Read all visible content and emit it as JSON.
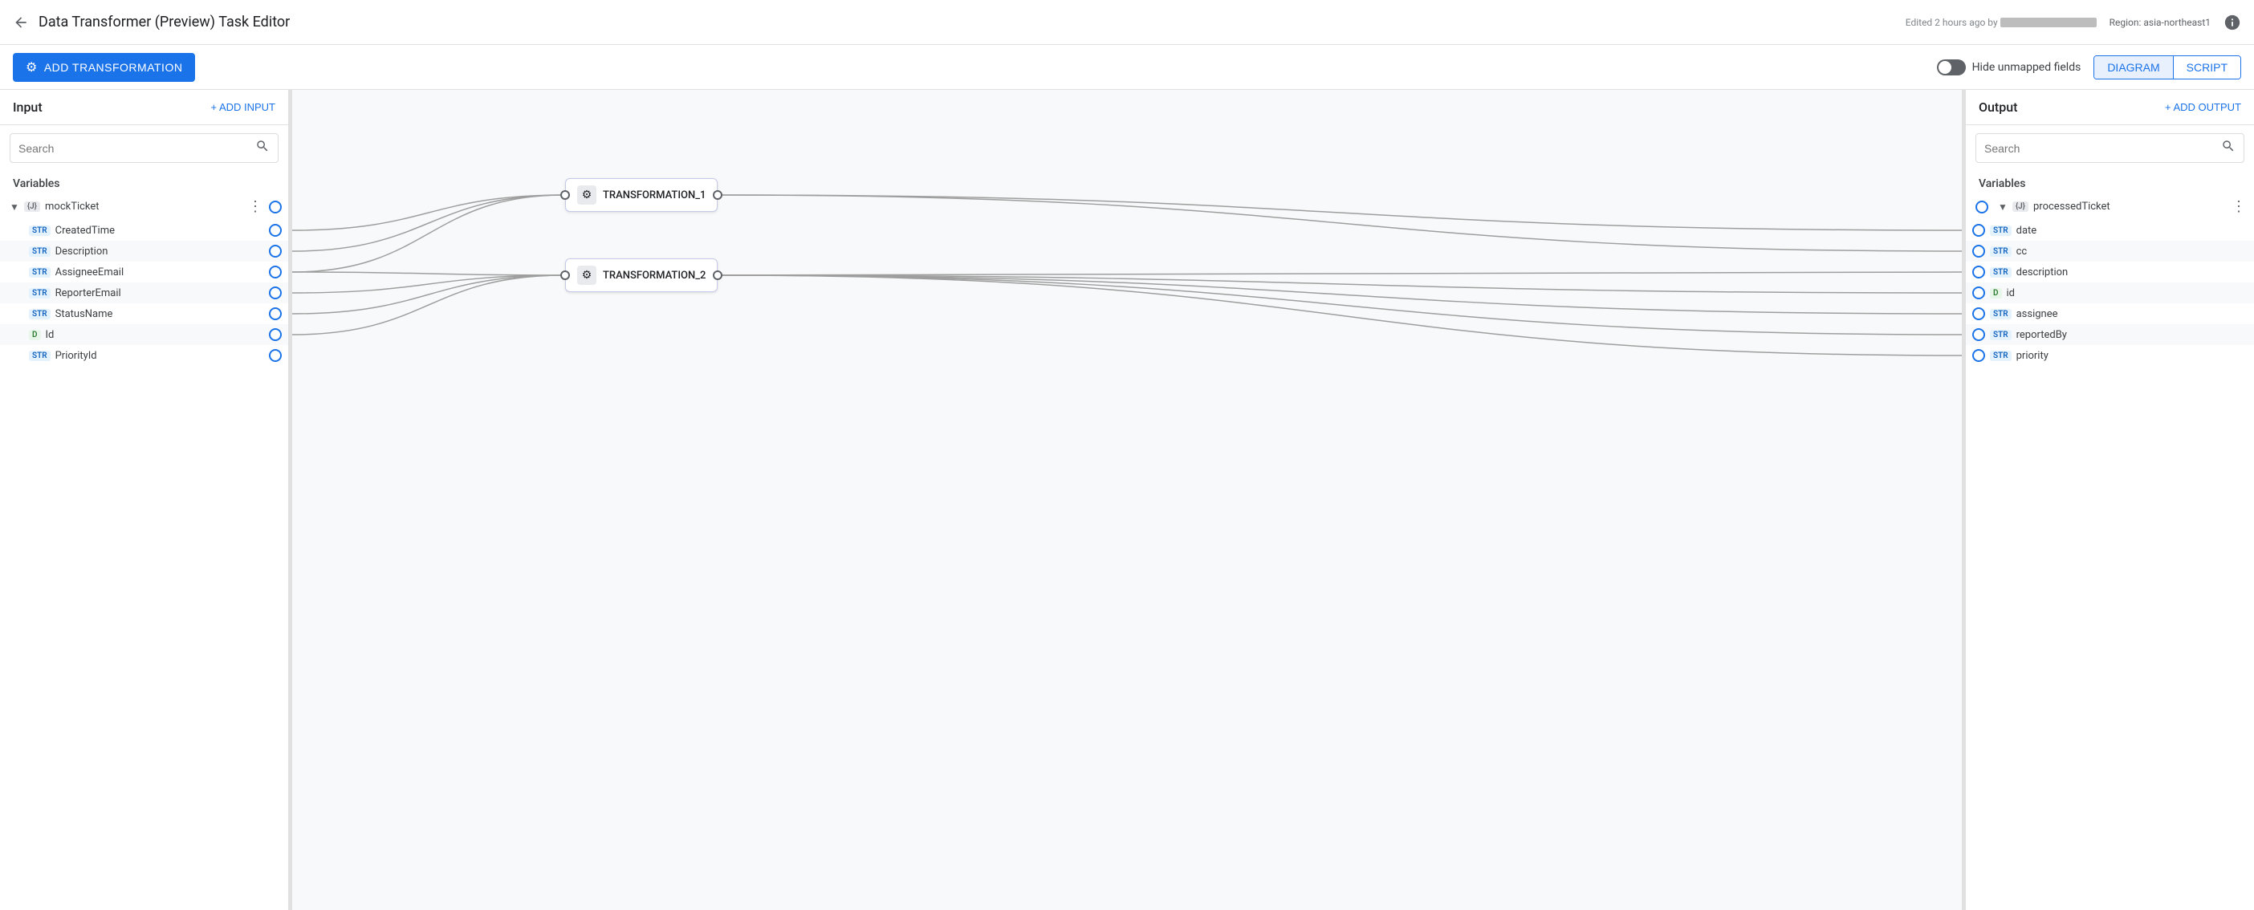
{
  "header": {
    "back_label": "←",
    "title": "Data Transformer (Preview) Task Editor",
    "meta_text": "Edited 2 hours ago by",
    "region_text": "Region: asia-northeast1",
    "info_icon": "info-circle-icon"
  },
  "toolbar": {
    "add_transformation_label": "ADD TRANSFORMATION",
    "hide_unmapped_label": "Hide unmapped fields",
    "diagram_tab_label": "DIAGRAM",
    "script_tab_label": "SCRIPT"
  },
  "input_panel": {
    "title": "Input",
    "add_input_label": "+ ADD INPUT",
    "search_placeholder": "Search",
    "variables_label": "Variables",
    "variable": {
      "name": "mockTicket",
      "fields": [
        {
          "type": "STR",
          "name": "CreatedTime"
        },
        {
          "type": "STR",
          "name": "Description"
        },
        {
          "type": "STR",
          "name": "AssigneeEmail"
        },
        {
          "type": "STR",
          "name": "ReporterEmail"
        },
        {
          "type": "STR",
          "name": "StatusName"
        },
        {
          "type": "D",
          "name": "Id"
        },
        {
          "type": "STR",
          "name": "PriorityId"
        }
      ]
    }
  },
  "output_panel": {
    "title": "Output",
    "add_output_label": "+ ADD OUTPUT",
    "search_placeholder": "Search",
    "variables_label": "Variables",
    "variable": {
      "name": "processedTicket",
      "fields": [
        {
          "type": "STR",
          "name": "date"
        },
        {
          "type": "STR",
          "name": "cc"
        },
        {
          "type": "STR",
          "name": "description"
        },
        {
          "type": "D",
          "name": "id"
        },
        {
          "type": "STR",
          "name": "assignee"
        },
        {
          "type": "STR",
          "name": "reportedBy"
        },
        {
          "type": "STR",
          "name": "priority"
        }
      ]
    }
  },
  "canvas": {
    "transform1_label": "TRANSFORMATION_1",
    "transform2_label": "TRANSFORMATION_2"
  }
}
